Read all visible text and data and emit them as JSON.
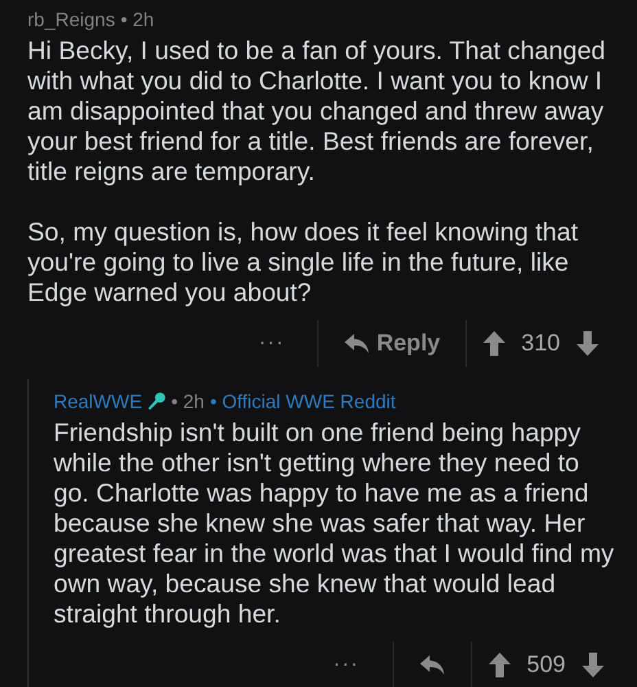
{
  "separator": "•",
  "comments": [
    {
      "kind": "top",
      "author": "rb_Reigns",
      "time": "2h",
      "paragraphs": [
        "Hi Becky, I used to be a fan of yours. That changed with what you did to Charlotte. I want you to know I am disappointed that you changed and threw away your best friend for a title. Best friends are forever, title reigns are temporary.",
        "So, my question is, how does it feel knowing that you're going to live a single life in the future, like Edge warned you about?"
      ],
      "more": "···",
      "reply": "Reply",
      "score": "310"
    },
    {
      "kind": "official",
      "author": "RealWWE",
      "time": "2h",
      "flair": "Official WWE Reddit",
      "paragraphs": [
        "Friendship isn't built on one friend being happy while the other isn't getting where they need to go. Charlotte was happy to have me as a friend because she knew she was safer that way. Her greatest fear in the world was that I would find my own way, because she knew that would lead straight through her."
      ],
      "more": "···",
      "score": "509"
    }
  ]
}
